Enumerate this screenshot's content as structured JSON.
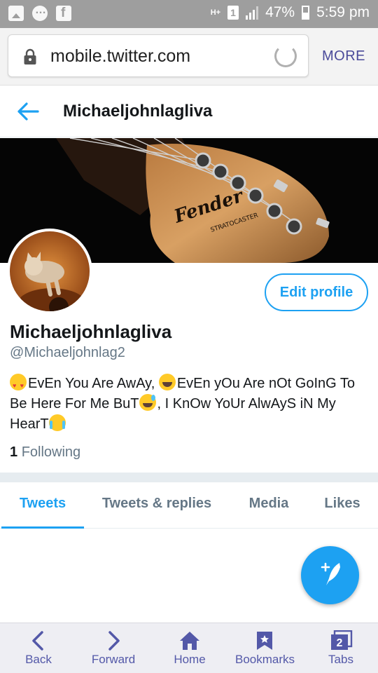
{
  "status_bar": {
    "network": "H+",
    "sim": "1",
    "battery": "47%",
    "time": "5:59 pm"
  },
  "browser": {
    "url": "mobile.twitter.com",
    "more_label": "MORE"
  },
  "header": {
    "title": "Michaeljohnlagliva"
  },
  "banner": {
    "brand": "Fender",
    "model": "STRATOCASTER"
  },
  "profile": {
    "edit_label": "Edit profile",
    "name": "Michaeljohnlagliva",
    "handle": "@Michaeljohnlag2",
    "bio_1": "EvEn You Are AwAy, ",
    "bio_2": "EvEn yOu Are nOt GoInG To Be Here For Me BuT",
    "bio_3": ", I KnOw YoUr AlwAyS iN My HearT",
    "following_count": "1",
    "following_label": "Following"
  },
  "tabs": [
    {
      "label": "Tweets"
    },
    {
      "label": "Tweets & replies"
    },
    {
      "label": "Media"
    },
    {
      "label": "Likes"
    }
  ],
  "bottom_bar": {
    "back": "Back",
    "forward": "Forward",
    "home": "Home",
    "bookmarks": "Bookmarks",
    "tabs": "Tabs",
    "tab_count": "2"
  },
  "colors": {
    "accent": "#1da1f2",
    "secondary_text": "#657786",
    "browser_accent": "#5358a8"
  },
  "icons": [
    "gallery-icon",
    "messenger-icon",
    "facebook-icon",
    "lock-icon",
    "reload-icon",
    "back-arrow-icon",
    "compose-icon",
    "back-icon",
    "forward-icon",
    "home-icon",
    "bookmark-icon",
    "tabs-icon"
  ]
}
